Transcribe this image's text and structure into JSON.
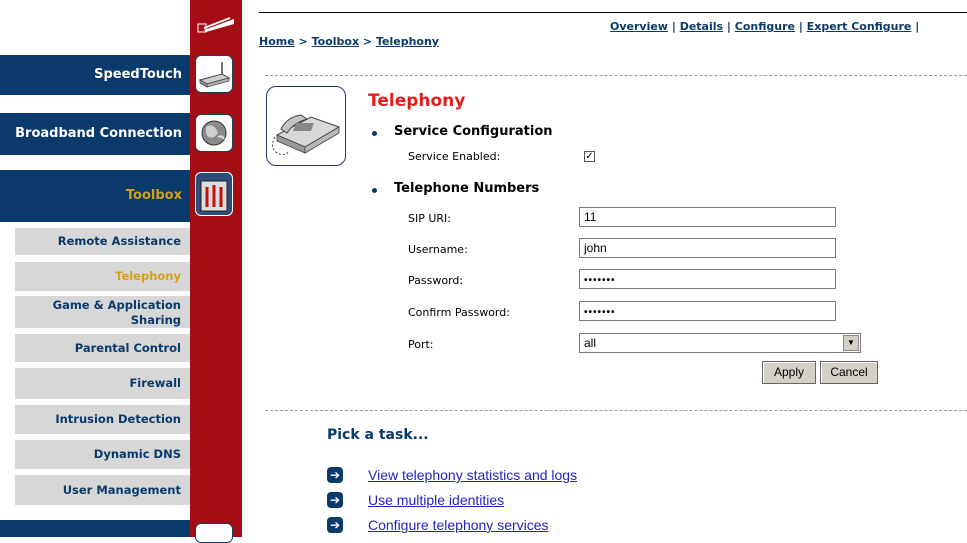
{
  "top_nav": {
    "overview": "Overview",
    "details": "Details",
    "configure": "Configure",
    "expert_configure": "Expert Configure",
    "sep": "|"
  },
  "breadcrumb": {
    "home": "Home",
    "toolbox": "Toolbox",
    "telephony": "Telephony",
    "sep": ">"
  },
  "sidebar": {
    "speedtouch": "SpeedTouch",
    "broadband": "Broadband Connection",
    "toolbox": "Toolbox",
    "items": [
      {
        "label": "Remote Assistance"
      },
      {
        "label": "Telephony"
      },
      {
        "label": "Game & Application Sharing"
      },
      {
        "label": "Parental Control"
      },
      {
        "label": "Firewall"
      },
      {
        "label": "Intrusion Detection"
      },
      {
        "label": "Dynamic DNS"
      },
      {
        "label": "User Management"
      }
    ]
  },
  "page": {
    "title": "Telephony",
    "service_config": {
      "heading": "Service Configuration",
      "enabled_label": "Service Enabled:",
      "enabled": true,
      "check_glyph": "✓"
    },
    "telephone_numbers": {
      "heading": "Telephone Numbers",
      "sip_uri_label": "SIP URI:",
      "sip_uri_value": "11",
      "username_label": "Username:",
      "username_value": "john",
      "password_label": "Password:",
      "password_value": "•••••••",
      "confirm_label": "Confirm Password:",
      "confirm_value": "•••••••",
      "port_label": "Port:",
      "port_value": "all"
    },
    "apply": "Apply",
    "cancel": "Cancel"
  },
  "tasks": {
    "title": "Pick a task...",
    "items": [
      {
        "label": "View telephony statistics and logs"
      },
      {
        "label": "Use multiple identities"
      },
      {
        "label": "Configure telephony services"
      }
    ]
  },
  "colors": {
    "navy": "#0a3a6b",
    "red_strip": "#a20e14",
    "title_red": "#e02020",
    "active_item": "#d4a017",
    "link_blue": "#2323c8"
  }
}
